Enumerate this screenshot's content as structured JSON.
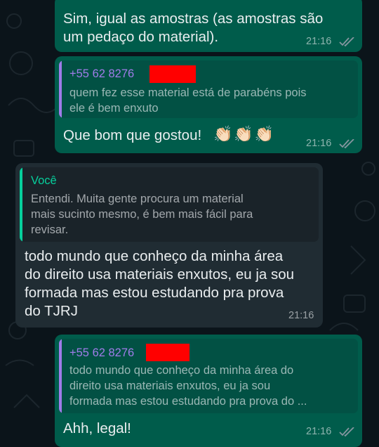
{
  "colors": {
    "background": "#0b141a",
    "outgoing_bubble": "#005c4b",
    "incoming_bubble": "#202c33",
    "quote_name_contact": "#a07ce9",
    "quote_name_self": "#06cf9c",
    "read_ticks": "#8696a0",
    "redaction": "#ff0000"
  },
  "messages": [
    {
      "id": "m1",
      "direction": "outgoing",
      "text": "Sim, igual as amostras (as amostras são\num pedaço do material).",
      "time": "21:16",
      "status_icon": "double-check-icon"
    },
    {
      "id": "m2",
      "direction": "outgoing",
      "quote": {
        "author": "+55 62 8276",
        "text": "quem fez esse material está de parabéns pois\nele é bem enxuto"
      },
      "text": "Que bom que gostou!",
      "emojis": "👏🏻👏🏻👏🏻",
      "time": "21:16",
      "status_icon": "double-check-icon"
    },
    {
      "id": "m3",
      "direction": "incoming",
      "quote": {
        "author": "Você",
        "text": "Entendi. Muita gente procura um material\nmais sucinto mesmo, é bem mais fácil para\nrevisar."
      },
      "text": "todo mundo que conheço da minha área\ndo direito usa materiais enxutos, eu ja sou\nformada mas estou estudando pra prova\ndo TJRJ",
      "time": "21:16"
    },
    {
      "id": "m4",
      "direction": "outgoing",
      "quote": {
        "author": "+55 62 8276",
        "text": "todo mundo que conheço da minha área do\ndireito usa materiais enxutos, eu ja sou\nformada mas estou estudando pra prova do ..."
      },
      "text": "Ahh, legal!",
      "time": "21:16",
      "status_icon": "double-check-icon"
    }
  ]
}
